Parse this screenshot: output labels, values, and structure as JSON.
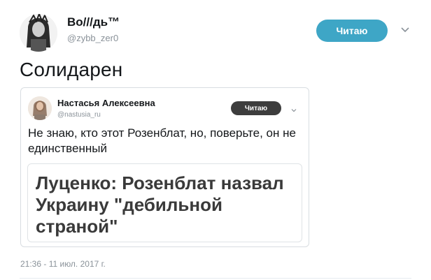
{
  "tweet": {
    "author_name": "Во///дь™",
    "author_handle": "@zybb_zer0",
    "follow_label": "Читаю",
    "text": "Солидарен",
    "timestamp": "21:36 - 11 июл. 2017 г."
  },
  "quoted_tweet": {
    "author_name": "Настасья Алексеевна",
    "author_handle": "@nastusia_ru",
    "follow_label": "Читаю",
    "text": "Не знаю, кто этот Розенблат, но, поверьте, он не единственный",
    "card_title": "Луценко: Розенблат назвал Украину \"дебильной страной\""
  },
  "icons": {
    "more": "chevron-down-icon"
  },
  "colors": {
    "follow_button": "#3ea6c6",
    "quote_follow_button": "#3d3d3d",
    "secondary_text": "#8a9299"
  }
}
